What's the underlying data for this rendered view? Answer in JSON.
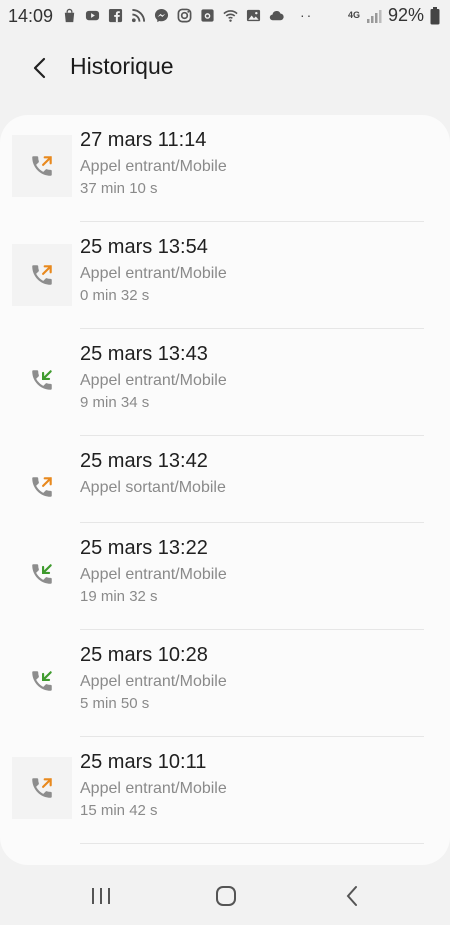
{
  "status_bar": {
    "time": "14:09",
    "network": "4G",
    "battery": "92%",
    "icons": [
      "shopping-bag-icon",
      "youtube-icon",
      "facebook-icon",
      "rss-icon",
      "messenger-icon",
      "instagram-icon",
      "camera-app-icon",
      "wifi-calling-icon",
      "gallery-icon",
      "cloud-icon"
    ],
    "more": "··"
  },
  "header": {
    "title": "Historique"
  },
  "colors": {
    "outgoing": "#e8891e",
    "incoming": "#3f9b2e",
    "phone": "#8d8d8d"
  },
  "calls": [
    {
      "date": "27 mars 11:14",
      "type": "Appel entrant/Mobile",
      "duration": "37 min 10 s",
      "arrow": "outgoing",
      "icon_bg": true
    },
    {
      "date": "25 mars 13:54",
      "type": "Appel entrant/Mobile",
      "duration": "0 min 32 s",
      "arrow": "outgoing",
      "icon_bg": true
    },
    {
      "date": "25 mars 13:43",
      "type": "Appel entrant/Mobile",
      "duration": "9 min 34 s",
      "arrow": "incoming",
      "icon_bg": false
    },
    {
      "date": "25 mars 13:42",
      "type": "Appel sortant/Mobile",
      "duration": "",
      "arrow": "outgoing",
      "icon_bg": false
    },
    {
      "date": "25 mars 13:22",
      "type": "Appel entrant/Mobile",
      "duration": "19 min 32 s",
      "arrow": "incoming",
      "icon_bg": false
    },
    {
      "date": "25 mars 10:28",
      "type": "Appel entrant/Mobile",
      "duration": "5 min 50 s",
      "arrow": "incoming",
      "icon_bg": false
    },
    {
      "date": "25 mars 10:11",
      "type": "Appel entrant/Mobile",
      "duration": "15 min 42 s",
      "arrow": "outgoing",
      "icon_bg": true
    }
  ]
}
